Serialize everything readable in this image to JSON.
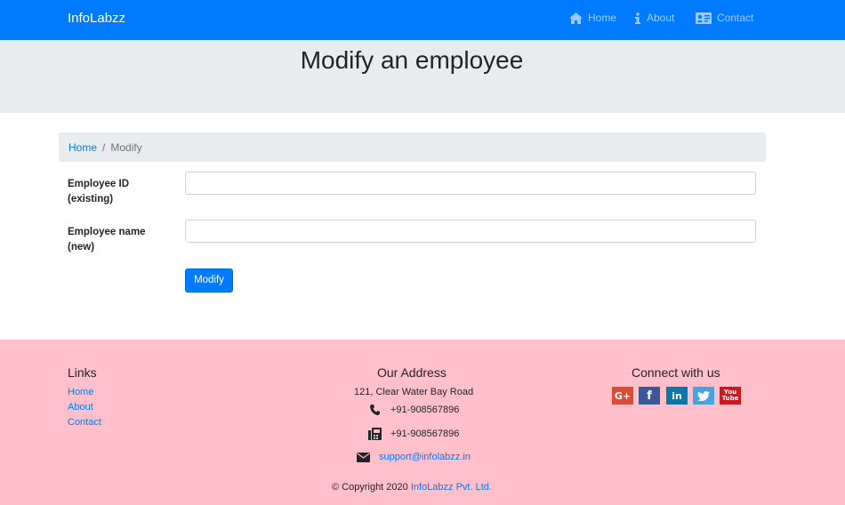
{
  "navbar": {
    "brand": "InfoLabzz",
    "links": [
      {
        "label": "Home",
        "icon": "home-icon"
      },
      {
        "label": "About",
        "icon": "info-icon"
      },
      {
        "label": "Contact",
        "icon": "contact-card-icon"
      }
    ]
  },
  "page": {
    "title": "Modify an employee"
  },
  "breadcrumb": {
    "home": "Home",
    "separator": "/",
    "current": "Modify"
  },
  "form": {
    "employee_id_label_line1": "Employee ID",
    "employee_id_label_line2": "(existing)",
    "employee_id_value": "",
    "employee_name_label_line1": "Employee name",
    "employee_name_label_line2": "(new)",
    "employee_name_value": "",
    "submit_label": "Modify"
  },
  "footer": {
    "links_title": "Links",
    "links": [
      "Home",
      "About",
      "Contact"
    ],
    "address_title": "Our Address",
    "address_line": "121, Clear Water Bay Road",
    "phone": "+91-908567896",
    "fax": "+91-908567896",
    "email": "support@infolabzz.in",
    "connect_title": "Connect with us",
    "social": [
      "google-plus-icon",
      "facebook-icon",
      "linkedin-icon",
      "twitter-icon",
      "youtube-icon"
    ],
    "copyright_prefix": "© Copyright 2020",
    "copyright_company": "InfoLabzz Pvt. Ltd."
  },
  "colors": {
    "primary": "#007bff",
    "jumbotron": "#e9ecef",
    "footer": "#ffc0cb"
  }
}
